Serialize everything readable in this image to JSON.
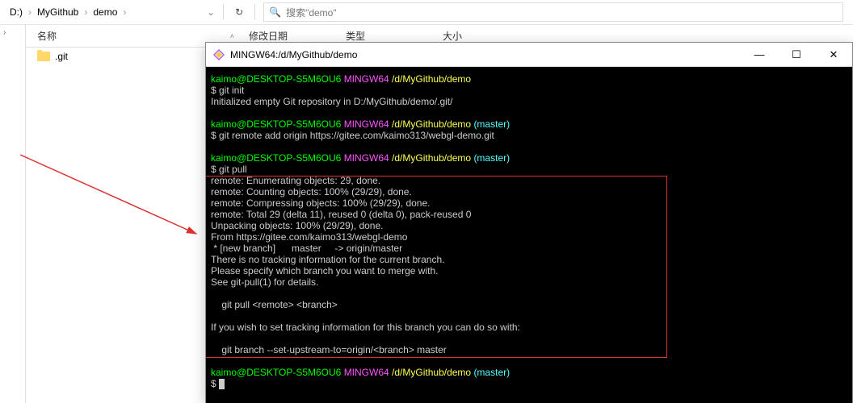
{
  "explorer": {
    "breadcrumb": [
      "D:)",
      "MyGithub",
      "demo"
    ],
    "refresh_glyph": "↻",
    "search_placeholder": "搜索\"demo\""
  },
  "columns": {
    "name": "名称",
    "date": "修改日期",
    "type": "类型",
    "size": "大小"
  },
  "files": [
    {
      "name": ".git"
    }
  ],
  "terminal": {
    "title": "MINGW64:/d/MyGithub/demo",
    "controls": {
      "min": "—",
      "max": "☐",
      "close": "✕"
    },
    "prompts": [
      {
        "user": "kaimo@DESKTOP-S5M6OU6",
        "env": "MINGW64",
        "path": "/d/MyGithub/demo",
        "branch": ""
      },
      {
        "user": "kaimo@DESKTOP-S5M6OU6",
        "env": "MINGW64",
        "path": "/d/MyGithub/demo",
        "branch": "(master)"
      },
      {
        "user": "kaimo@DESKTOP-S5M6OU6",
        "env": "MINGW64",
        "path": "/d/MyGithub/demo",
        "branch": "(master)"
      },
      {
        "user": "kaimo@DESKTOP-S5M6OU6",
        "env": "MINGW64",
        "path": "/d/MyGithub/demo",
        "branch": "(master)"
      }
    ],
    "cmd1": "$ git init",
    "out1": "Initialized empty Git repository in D:/MyGithub/demo/.git/",
    "cmd2": "$ git remote add origin https://gitee.com/kaimo313/webgl-demo.git",
    "cmd3": "$ git pull",
    "box": [
      "remote: Enumerating objects: 29, done.",
      "remote: Counting objects: 100% (29/29), done.",
      "remote: Compressing objects: 100% (29/29), done.",
      "remote: Total 29 (delta 11), reused 0 (delta 0), pack-reused 0",
      "Unpacking objects: 100% (29/29), done.",
      "From https://gitee.com/kaimo313/webgl-demo",
      " * [new branch]      master     -> origin/master",
      "There is no tracking information for the current branch.",
      "Please specify which branch you want to merge with.",
      "See git-pull(1) for details.",
      "",
      "    git pull <remote> <branch>",
      "",
      "If you wish to set tracking information for this branch you can do so with:",
      "",
      "    git branch --set-upstream-to=origin/<branch> master"
    ],
    "cmd4": "$ "
  }
}
